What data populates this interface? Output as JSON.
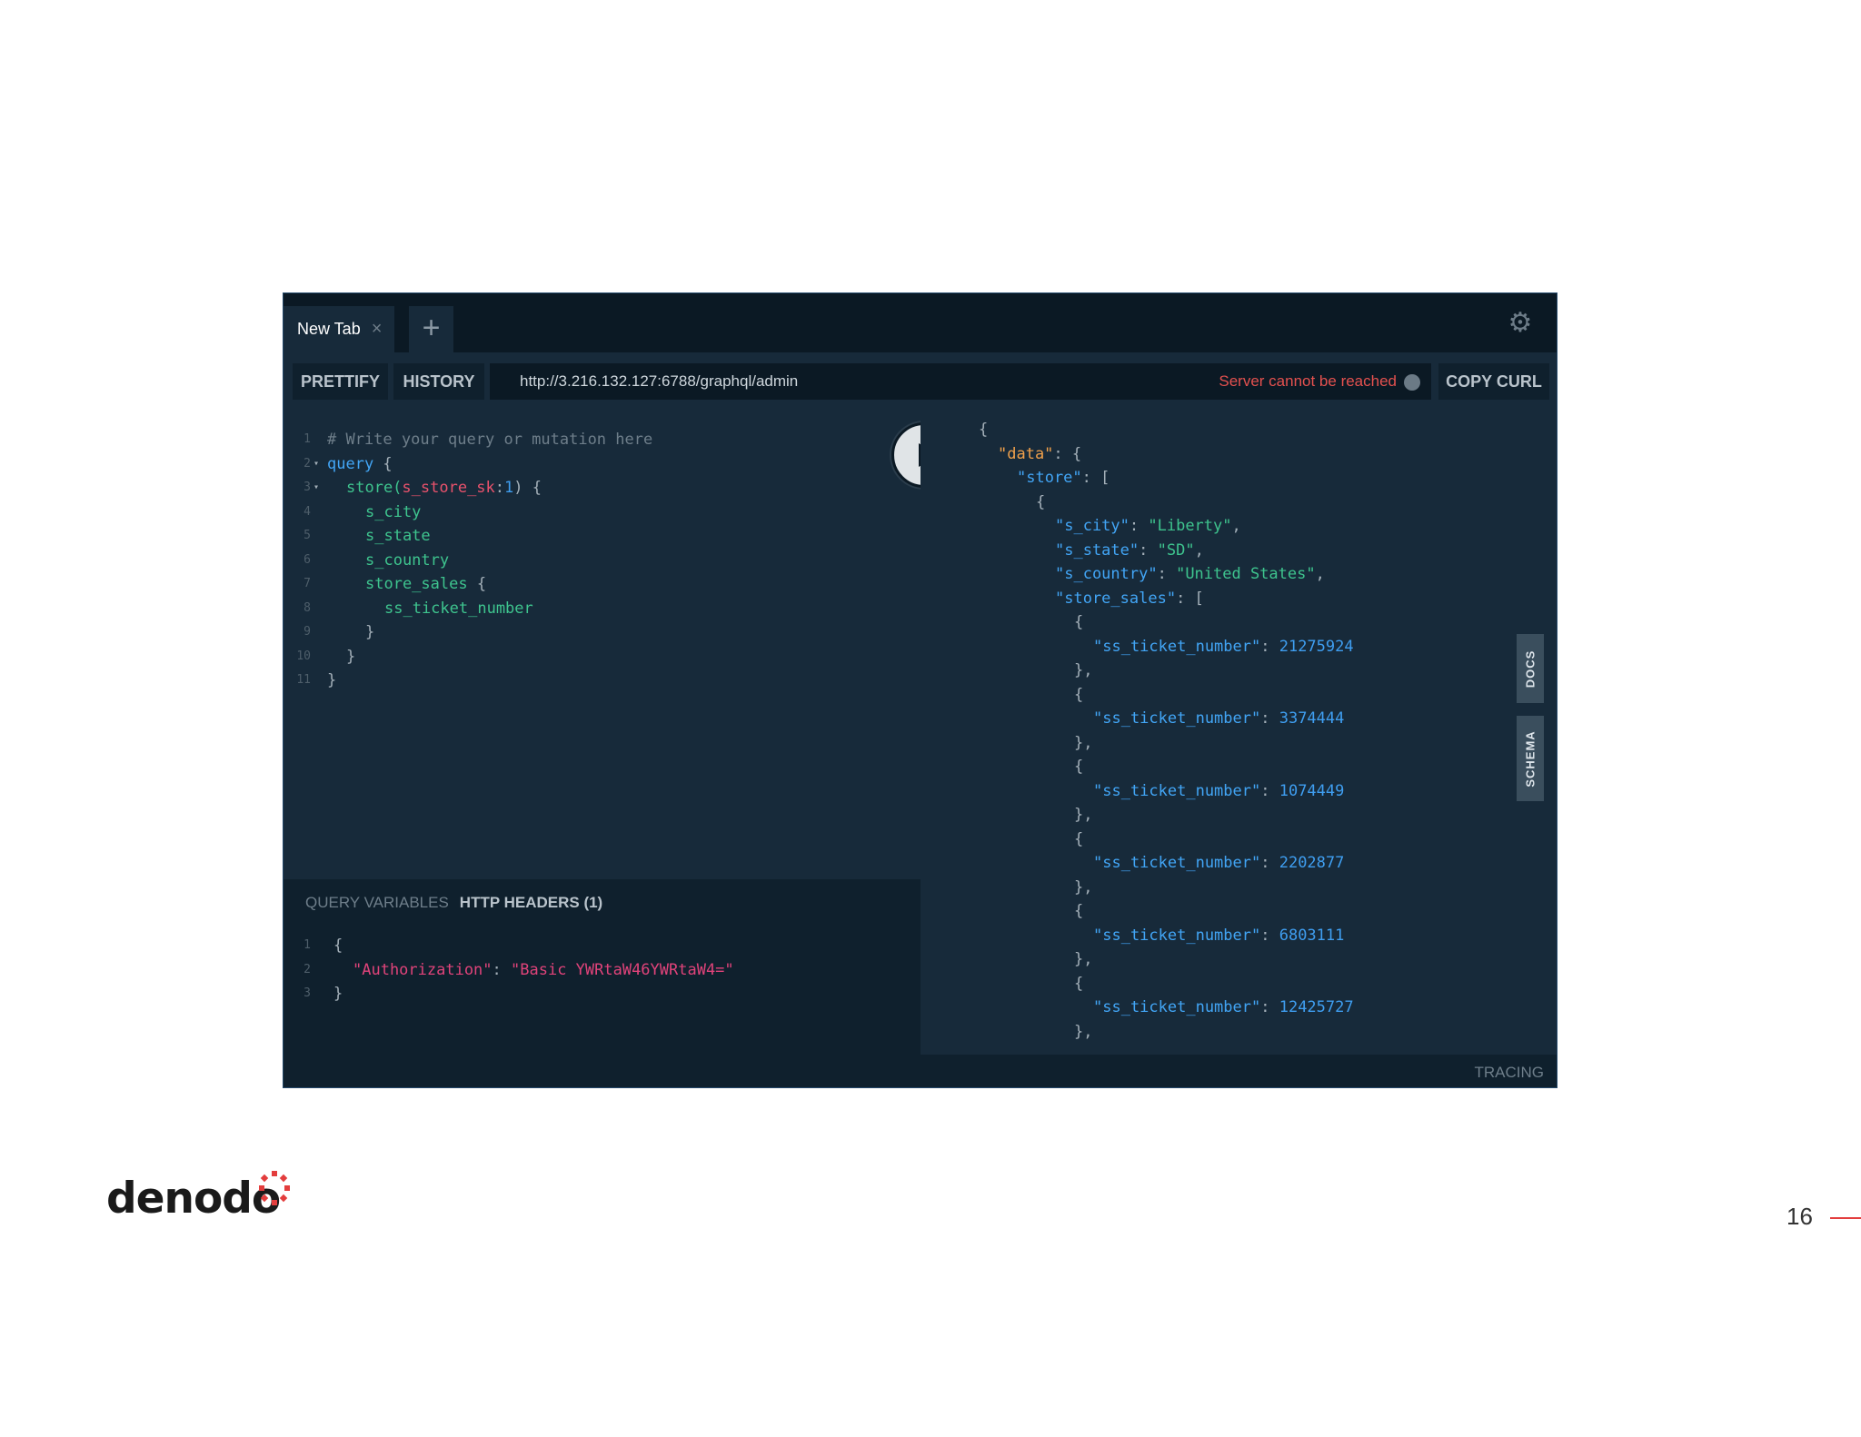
{
  "tabs": {
    "active_label": "New Tab",
    "close_symbol": "×",
    "add_symbol": "+"
  },
  "toolbar": {
    "prettify": "PRETTIFY",
    "history": "HISTORY",
    "url": "http://3.216.132.127:6788/graphql/admin",
    "server_status": "Server cannot be reached",
    "copy_curl": "COPY CURL"
  },
  "editor": {
    "line_numbers": [
      "1",
      "2",
      "3",
      "4",
      "5",
      "6",
      "7",
      "8",
      "9",
      "10",
      "11"
    ],
    "lines": {
      "l1": "# Write your query or mutation here",
      "l2_kw": "query",
      "l2_rest": " {",
      "l3_field": "store(",
      "l3_arg": "s_store_sk",
      "l3_colon": ":",
      "l3_num": "1",
      "l3_rest": ") {",
      "l4": "s_city",
      "l5": "s_state",
      "l6": "s_country",
      "l7_field": "store_sales",
      "l7_rest": " {",
      "l8": "ss_ticket_number",
      "l9": "}",
      "l10": "}",
      "l11": "}"
    }
  },
  "variables": {
    "tab_query_variables": "QUERY VARIABLES",
    "tab_http_headers": "HTTP HEADERS (1)",
    "line_numbers": [
      "1",
      "2",
      "3"
    ],
    "open": "{",
    "key": "\"Authorization\"",
    "colon": ": ",
    "value": "\"Basic YWRtaW46YWRtaW4=\"",
    "close": "}"
  },
  "result": {
    "open_brace": "{",
    "data_key": "\"data\"",
    "store_key": "\"store\"",
    "city_key": "\"s_city\"",
    "city_val": "\"Liberty\"",
    "state_key": "\"s_state\"",
    "state_val": "\"SD\"",
    "country_key": "\"s_country\"",
    "country_val": "\"United States\"",
    "sales_key": "\"store_sales\"",
    "ticket_key": "\"ss_ticket_number\"",
    "tickets": [
      "21275924",
      "3374444",
      "1074449",
      "2202877",
      "6803111",
      "12425727"
    ]
  },
  "side_tabs": {
    "docs": "DOCS",
    "schema": "SCHEMA"
  },
  "footer": {
    "tracing": "TRACING"
  },
  "slide": {
    "logo_text": "denodo",
    "page_number": "16"
  },
  "icons": {
    "settings": "gear-icon",
    "run": "play-icon"
  },
  "colors": {
    "accent_red": "#e33d3d",
    "error": "#e4514f",
    "bg_dark": "#0f202d"
  }
}
